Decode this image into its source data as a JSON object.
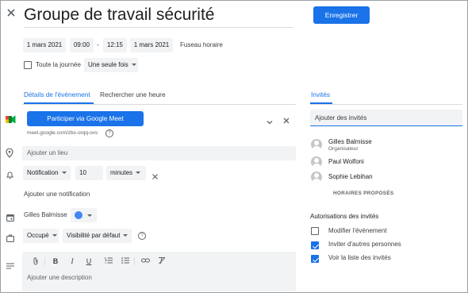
{
  "header": {
    "title": "Groupe de travail sécurité",
    "save_label": "Enregistrer"
  },
  "datetime": {
    "start_date": "1 mars 2021",
    "start_time": "09:00",
    "separator": "-",
    "end_time": "12:15",
    "end_date": "1 mars 2021",
    "timezone_label": "Fuseau horaire",
    "all_day_label": "Toute la journée",
    "recurrence": "Une seule fois"
  },
  "tabs": {
    "details": "Détails de l'événement",
    "find_time": "Rechercher une heure",
    "guests": "Invités"
  },
  "meet": {
    "button_label": "Participer via Google Meet",
    "link": "meet.google.com/zbx-orqq-ovs"
  },
  "location": {
    "placeholder": "Ajouter un lieu"
  },
  "notification": {
    "type": "Notification",
    "amount": "10",
    "unit": "minutes",
    "add_label": "Ajouter une notification"
  },
  "calendar": {
    "owner": "Gilles Balmisse",
    "color": "#4285f4"
  },
  "availability": {
    "status": "Occupé",
    "visibility": "Visibilité par défaut"
  },
  "description": {
    "placeholder": "Ajouter une description"
  },
  "guests": {
    "placeholder": "Ajouter des invités",
    "list": [
      {
        "name": "Gilles Balmisse",
        "role": "Organisateur"
      },
      {
        "name": "Paul Wolfoni",
        "role": ""
      },
      {
        "name": "Sophie Lebihan",
        "role": ""
      }
    ],
    "suggested_times": "HORAIRES PROPOSÉS",
    "permissions_title": "Autorisations des invités",
    "permissions": [
      {
        "label": "Modifier l'événement",
        "checked": false
      },
      {
        "label": "Inviter d'autres personnes",
        "checked": true
      },
      {
        "label": "Voir la liste des invités",
        "checked": true
      }
    ]
  },
  "colors": {
    "accent": "#1a73e8"
  }
}
